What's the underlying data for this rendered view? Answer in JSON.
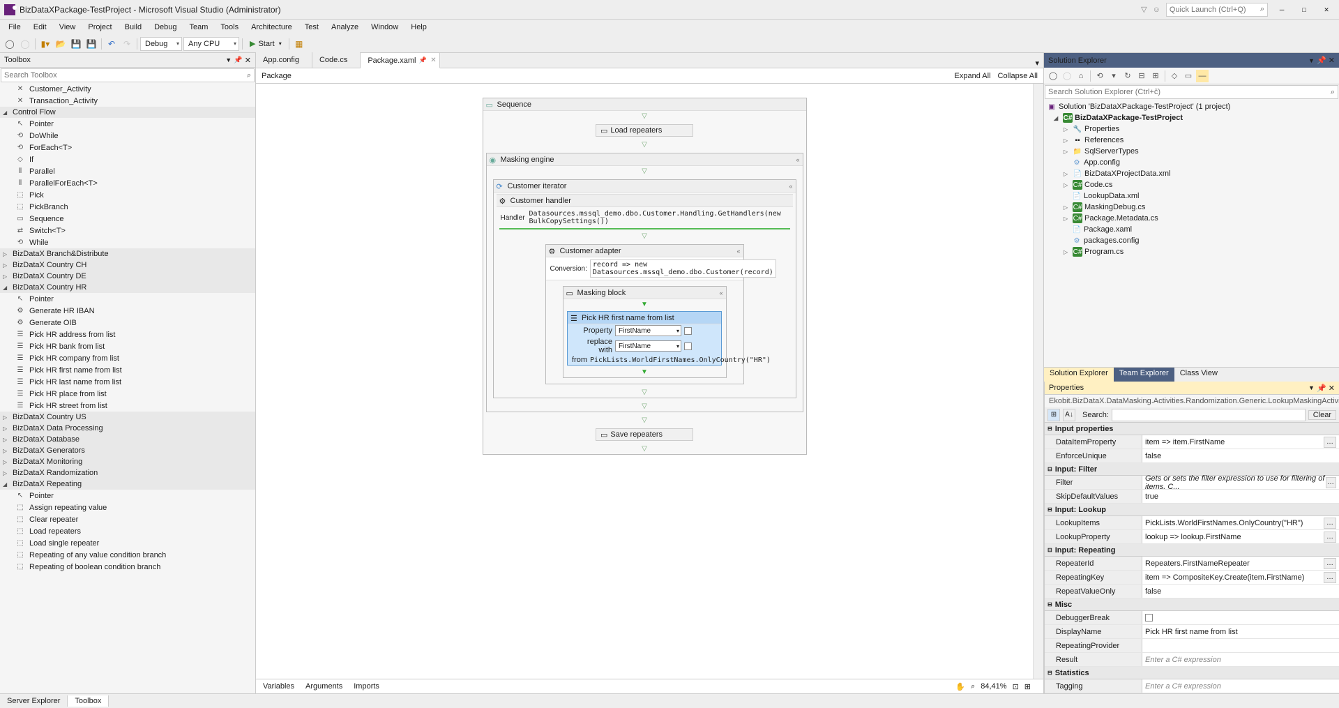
{
  "title": "BizDataXPackage-TestProject - Microsoft Visual Studio (Administrator)",
  "quick_launch_ph": "Quick Launch (Ctrl+Q)",
  "menu": [
    "File",
    "Edit",
    "View",
    "Project",
    "Build",
    "Debug",
    "Team",
    "Tools",
    "Architecture",
    "Test",
    "Analyze",
    "Window",
    "Help"
  ],
  "config": {
    "debug": "Debug",
    "platform": "Any CPU",
    "start": "Start"
  },
  "toolbox": {
    "title": "Toolbox",
    "search_ph": "Search Toolbox",
    "top_items": [
      "Customer_Activity",
      "Transaction_Activity"
    ],
    "cat_controlflow": "Control Flow",
    "controlflow": [
      "Pointer",
      "DoWhile",
      "ForEach<T>",
      "If",
      "Parallel",
      "ParallelForEach<T>",
      "Pick",
      "PickBranch",
      "Sequence",
      "Switch<T>",
      "While"
    ],
    "cats_collapsed": [
      "BizDataX Branch&Distribute",
      "BizDataX Country CH",
      "BizDataX Country DE"
    ],
    "cat_hr": "BizDataX Country HR",
    "hr": [
      "Pointer",
      "Generate HR IBAN",
      "Generate OIB",
      "Pick HR address from list",
      "Pick HR bank from list",
      "Pick HR company from list",
      "Pick HR first name from list",
      "Pick HR last name from list",
      "Pick HR place from list",
      "Pick HR street from list"
    ],
    "cats_collapsed2": [
      "BizDataX Country US",
      "BizDataX Data Processing",
      "BizDataX Database",
      "BizDataX Generators",
      "BizDataX Monitoring",
      "BizDataX Randomization"
    ],
    "cat_repeating": "BizDataX Repeating",
    "repeating": [
      "Pointer",
      "Assign repeating value",
      "Clear repeater",
      "Load repeaters",
      "Load single repeater",
      "Repeating of any value condition branch",
      "Repeating of boolean condition branch"
    ]
  },
  "tabs": [
    "App.config",
    "Code.cs",
    "Package.xaml"
  ],
  "breadcrumb": "Package",
  "expand_all": "Expand All",
  "collapse_all": "Collapse All",
  "wf": {
    "sequence": "Sequence",
    "load": "Load repeaters",
    "masking_engine": "Masking engine",
    "customer_iterator": "Customer iterator",
    "customer_handler": "Customer handler",
    "handler_lbl": "Handler",
    "handler_code": "Datasources.mssql_demo.dbo.Customer.Handling.GetHandlers(new BulkCopySettings())",
    "customer_adapter": "Customer adapter",
    "conversion_lbl": "Conversion:",
    "conversion_code": "record => new Datasources.mssql_demo.dbo.Customer(record)",
    "masking_block": "Masking block",
    "pick_activity": "Pick HR first name from list",
    "property_lbl": "Property",
    "property_val": "FirstName",
    "replace_lbl": "replace with",
    "replace_val": "FirstName",
    "from_lbl": "from",
    "from_code": "PickLists.WorldFirstNames.OnlyCountry(\"HR\")",
    "save": "Save repeaters"
  },
  "editor_bottom": {
    "variables": "Variables",
    "arguments": "Arguments",
    "imports": "Imports",
    "zoom": "84,41%"
  },
  "solexp": {
    "title": "Solution Explorer",
    "search_ph": "Search Solution Explorer (Ctrl+č)",
    "solution": "Solution 'BizDataXPackage-TestProject' (1 project)",
    "project": "BizDataXPackage-TestProject",
    "nodes": [
      "Properties",
      "References",
      "SqlServerTypes",
      "App.config",
      "BizDataXProjectData.xml",
      "Code.cs",
      "LookupData.xml",
      "MaskingDebug.cs",
      "Package.Metadata.cs",
      "Package.xaml",
      "packages.config",
      "Program.cs"
    ],
    "tabs": [
      "Solution Explorer",
      "Team Explorer",
      "Class View"
    ]
  },
  "props": {
    "title": "Properties",
    "type": "Ekobit.BizDataX.DataMasking.Activities.Randomization.Generic.LookupMaskingActivity<BizDataXP...",
    "search_lbl": "Search:",
    "clear": "Clear",
    "cats": {
      "input_properties": "Input properties",
      "input_filter": "Input: Filter",
      "input_lookup": "Input: Lookup",
      "input_repeating": "Input: Repeating",
      "misc": "Misc",
      "statistics": "Statistics"
    },
    "rows": {
      "DataItemProperty": "item => item.FirstName",
      "EnforceUnique": "false",
      "Filter_ph": "Gets or sets the filter expression to use for filtering of items. C...",
      "SkipDefaultValues": "true",
      "LookupItems": "PickLists.WorldFirstNames.OnlyCountry(\"HR\")",
      "LookupProperty": "lookup => lookup.FirstName",
      "RepeaterId": "Repeaters.FirstNameRepeater",
      "RepeatingKey": "item => CompositeKey.Create(item.FirstName)",
      "RepeatValueOnly": "false",
      "DebuggerBreak": "",
      "DisplayName": "Pick HR first name from list",
      "RepeatingProvider": "",
      "Result_ph": "Enter a C# expression",
      "Tagging_lbl": "Tagging",
      "Tagging_ph": "Enter a C# expression"
    }
  },
  "bottom": {
    "server_explorer": "Server Explorer",
    "toolbox": "Toolbox"
  }
}
